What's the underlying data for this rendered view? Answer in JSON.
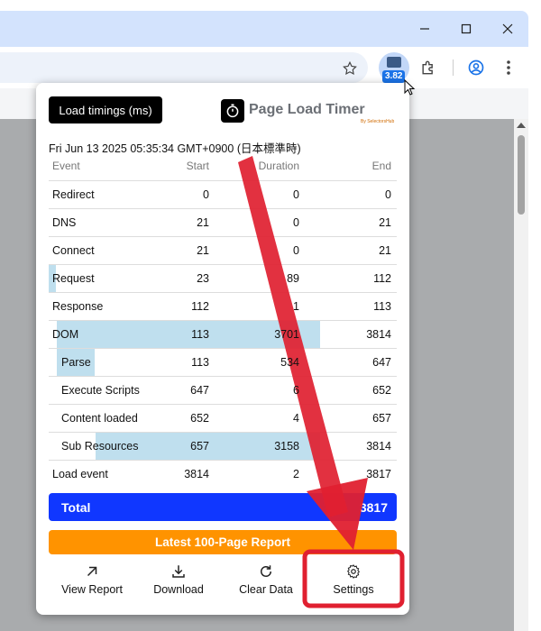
{
  "extension": {
    "badge": "3.82"
  },
  "popup": {
    "load_timings_button": "Load timings (ms)",
    "logo_title": "Page Load Timer",
    "logo_subtitle": "By SelectorsHub",
    "datetime": "Fri Jun 13 2025 05:35:34 GMT+0900 (日本標準時)",
    "table": {
      "headers": [
        "Event",
        "Start",
        "Duration",
        "End"
      ],
      "rows": [
        {
          "event": "Redirect",
          "start": "0",
          "duration": "0",
          "end": "0"
        },
        {
          "event": "DNS",
          "start": "21",
          "duration": "0",
          "end": "21"
        },
        {
          "event": "Connect",
          "start": "21",
          "duration": "0",
          "end": "21"
        },
        {
          "event": "Request",
          "start": "23",
          "duration": "89",
          "end": "112"
        },
        {
          "event": "Response",
          "start": "112",
          "duration": "1",
          "end": "113"
        },
        {
          "event": "DOM",
          "start": "113",
          "duration": "3701",
          "end": "3814"
        },
        {
          "event": "Parse",
          "start": "113",
          "duration": "534",
          "end": "647"
        },
        {
          "event": "Execute Scripts",
          "start": "647",
          "duration": "6",
          "end": "652"
        },
        {
          "event": "Content loaded",
          "start": "652",
          "duration": "4",
          "end": "657"
        },
        {
          "event": "Sub Resources",
          "start": "657",
          "duration": "3158",
          "end": "3814"
        },
        {
          "event": "Load event",
          "start": "3814",
          "duration": "2",
          "end": "3817"
        }
      ]
    },
    "total_label": "Total",
    "total_value": "3817",
    "report_button": "Latest 100-Page Report",
    "actions": {
      "view_report": "View Report",
      "download": "Download",
      "clear_data": "Clear Data",
      "settings": "Settings"
    }
  },
  "colors": {
    "total_bg": "#1037ff",
    "report_bg": "#ff9300",
    "bar": "#bfdfee",
    "annotation": "#e02030"
  }
}
